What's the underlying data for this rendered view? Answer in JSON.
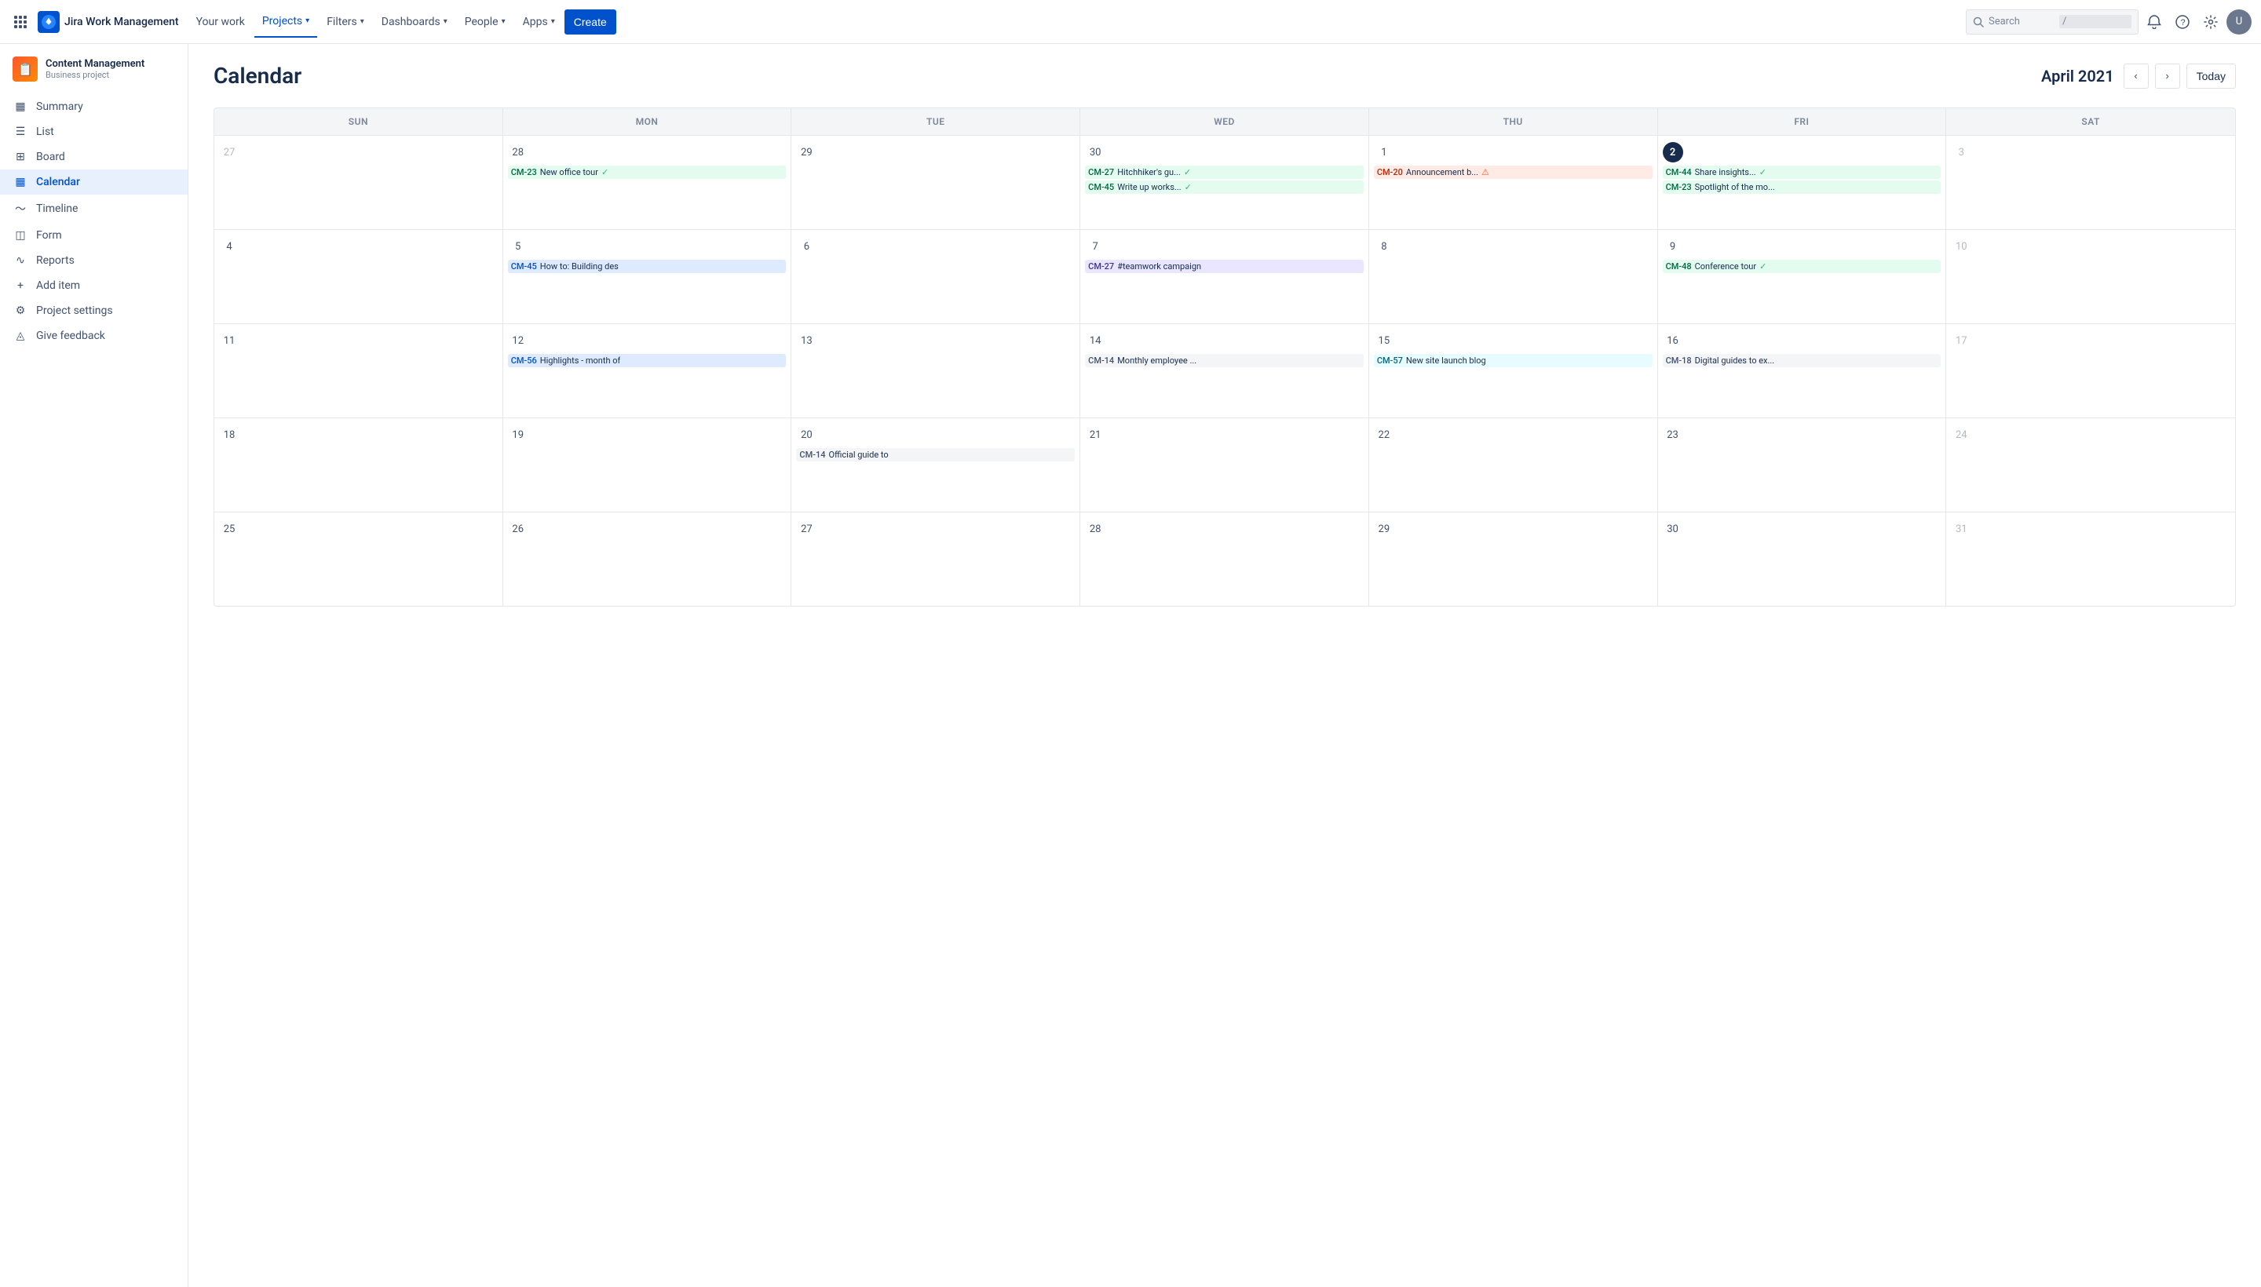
{
  "app": {
    "name": "Jira Work Management"
  },
  "topnav": {
    "logo_text": "Jira Work Management",
    "your_work": "Your work",
    "projects": "Projects",
    "filters": "Filters",
    "dashboards": "Dashboards",
    "people": "People",
    "apps": "Apps",
    "create": "Create",
    "search_placeholder": "Search",
    "search_hint": "/"
  },
  "sidebar": {
    "project_name": "Content Management",
    "project_type": "Business project",
    "items": [
      {
        "id": "summary",
        "label": "Summary",
        "icon": "▦"
      },
      {
        "id": "list",
        "label": "List",
        "icon": "≡"
      },
      {
        "id": "board",
        "label": "Board",
        "icon": "⊞"
      },
      {
        "id": "calendar",
        "label": "Calendar",
        "icon": "📅",
        "active": true
      },
      {
        "id": "timeline",
        "label": "Timeline",
        "icon": "≈"
      },
      {
        "id": "form",
        "label": "Form",
        "icon": "◫"
      },
      {
        "id": "reports",
        "label": "Reports",
        "icon": "∿"
      },
      {
        "id": "add-item",
        "label": "Add item",
        "icon": "⊕"
      },
      {
        "id": "project-settings",
        "label": "Project settings",
        "icon": "⚙"
      },
      {
        "id": "give-feedback",
        "label": "Give feedback",
        "icon": "◬"
      }
    ]
  },
  "calendar": {
    "title": "Calendar",
    "month": "April 2021",
    "today_btn": "Today",
    "day_headers": [
      "SUN",
      "MON",
      "TUE",
      "WED",
      "THU",
      "FRI",
      "SAT"
    ],
    "weeks": [
      {
        "days": [
          {
            "date": "27",
            "other": true,
            "events": []
          },
          {
            "date": "28",
            "events": [
              {
                "id": "CM-23",
                "title": "New office tour",
                "color": "green",
                "check": true
              }
            ]
          },
          {
            "date": "29",
            "events": []
          },
          {
            "date": "30",
            "events": [
              {
                "id": "CM-27",
                "title": "Hitchhiker's gu...",
                "color": "green",
                "check": true
              },
              {
                "id": "CM-45",
                "title": "Write up works...",
                "color": "green",
                "check": true
              }
            ]
          },
          {
            "date": "1",
            "events": [
              {
                "id": "CM-20",
                "title": "Announcement b...",
                "color": "red",
                "error": true
              }
            ]
          },
          {
            "date": "2",
            "today": true,
            "events": [
              {
                "id": "CM-44",
                "title": "Share insights...",
                "color": "green",
                "check": true
              },
              {
                "id": "CM-23",
                "title": "Spotlight of the mo...",
                "color": "green"
              }
            ]
          },
          {
            "date": "3",
            "other": true,
            "events": []
          }
        ]
      },
      {
        "days": [
          {
            "date": "4",
            "events": []
          },
          {
            "date": "5",
            "events": [
              {
                "id": "CM-45",
                "title": "How to: Building des",
                "color": "blue"
              }
            ]
          },
          {
            "date": "6",
            "events": []
          },
          {
            "date": "7",
            "events": [
              {
                "id": "CM-27",
                "title": "#teamwork campaign",
                "color": "purple"
              }
            ]
          },
          {
            "date": "8",
            "events": []
          },
          {
            "date": "9",
            "events": [
              {
                "id": "CM-48",
                "title": "Conference tour",
                "color": "green",
                "check": true
              }
            ]
          },
          {
            "date": "10",
            "other": true,
            "events": []
          }
        ]
      },
      {
        "days": [
          {
            "date": "11",
            "events": []
          },
          {
            "date": "12",
            "events": [
              {
                "id": "CM-56",
                "title": "Highlights - month of",
                "color": "blue"
              }
            ]
          },
          {
            "date": "13",
            "events": []
          },
          {
            "date": "14",
            "events": [
              {
                "id": "CM-14",
                "title": "Monthly employee ...",
                "color": "gray"
              }
            ]
          },
          {
            "date": "15",
            "events": [
              {
                "id": "CM-57",
                "title": "New site launch blog",
                "color": "teal"
              }
            ]
          },
          {
            "date": "16",
            "events": [
              {
                "id": "CM-18",
                "title": "Digital guides to ex...",
                "color": "gray"
              }
            ]
          },
          {
            "date": "17",
            "other": true,
            "events": []
          }
        ]
      },
      {
        "days": [
          {
            "date": "18",
            "events": []
          },
          {
            "date": "19",
            "events": []
          },
          {
            "date": "20",
            "events": [
              {
                "id": "CM-14",
                "title": "Official guide to",
                "color": "gray"
              }
            ]
          },
          {
            "date": "21",
            "events": []
          },
          {
            "date": "22",
            "events": []
          },
          {
            "date": "23",
            "events": []
          },
          {
            "date": "24",
            "other": true,
            "events": []
          }
        ]
      },
      {
        "days": [
          {
            "date": "25",
            "events": []
          },
          {
            "date": "26",
            "events": []
          },
          {
            "date": "27",
            "events": []
          },
          {
            "date": "28",
            "events": []
          },
          {
            "date": "29",
            "events": []
          },
          {
            "date": "30",
            "events": []
          },
          {
            "date": "31",
            "other": true,
            "events": []
          }
        ]
      }
    ]
  }
}
